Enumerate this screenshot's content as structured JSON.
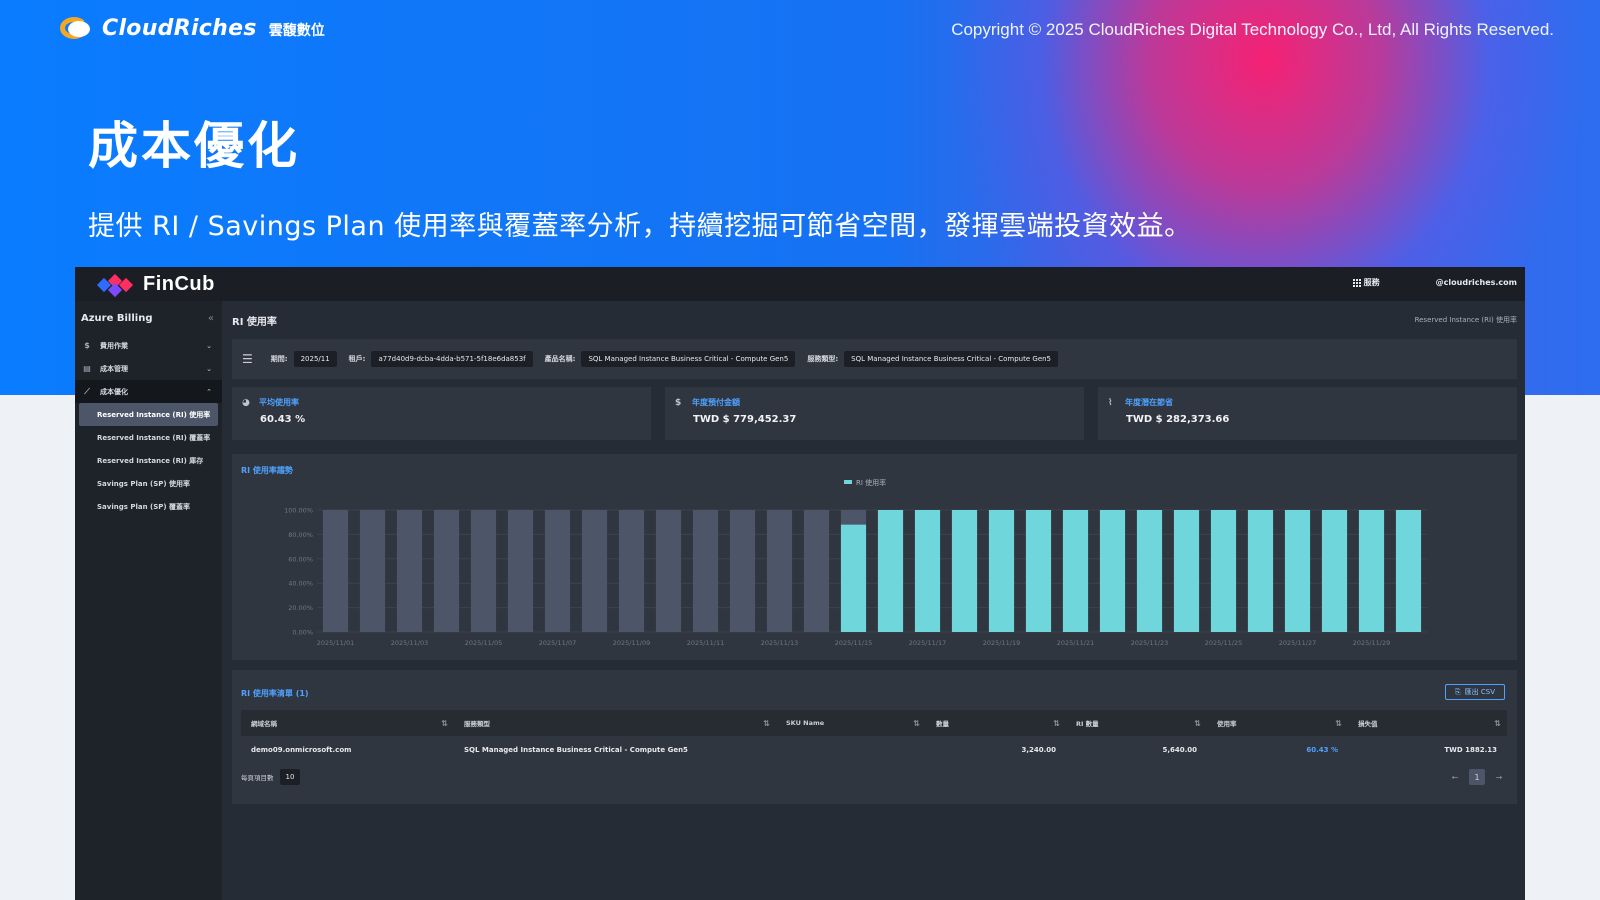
{
  "hero": {
    "brand_name": "CloudRiches",
    "brand_cn": "雲馥數位",
    "copyright": "Copyright © 2025 CloudRiches Digital Technology Co., Ltd, All Rights Reserved.",
    "title": "成本優化",
    "subtitle": "提供 RI / Savings Plan 使用率與覆蓋率分析，持續挖掘可節省空間，發揮雲端投資效益。"
  },
  "app": {
    "logo_text": "FinCub",
    "apps_label": "服務",
    "account": "@cloudriches.com",
    "sidebar": {
      "title": "Azure Billing",
      "collapse_icon": "«",
      "groups": [
        {
          "label": "費用作業",
          "icon": "dollar-icon",
          "expanded": false
        },
        {
          "label": "成本管理",
          "icon": "chart-box-icon",
          "expanded": false
        },
        {
          "label": "成本優化",
          "icon": "trend-icon",
          "expanded": true
        }
      ],
      "sub_items": [
        {
          "label": "Reserved Instance (RI) 使用率",
          "active": true
        },
        {
          "label": "Reserved Instance (RI) 覆蓋率",
          "active": false
        },
        {
          "label": "Reserved Instance (RI) 庫存",
          "active": false
        },
        {
          "label": "Savings Plan (SP) 使用率",
          "active": false
        },
        {
          "label": "Savings Plan (SP) 覆蓋率",
          "active": false
        }
      ]
    },
    "page": {
      "title": "RI 使用率",
      "breadcrumb": "Reserved Instance (RI) 使用率"
    },
    "filters": {
      "period_label": "期間:",
      "period_value": "2025/11",
      "tenant_label": "租戶:",
      "tenant_value": "a77d40d9-dcba-4dda-b571-5f18e6da853f",
      "product_label": "產品名稱:",
      "product_value": "SQL Managed Instance Business Critical - Compute Gen5",
      "service_label": "服務類型:",
      "service_value": "SQL Managed Instance Business Critical - Compute Gen5"
    },
    "kpis": [
      {
        "label": "平均使用率",
        "value": "60.43 %",
        "icon": "pie-icon"
      },
      {
        "label": "年度預付金額",
        "value": "TWD $ 779,452.37",
        "icon": "dollar-icon"
      },
      {
        "label": "年度潛在節省",
        "value": "TWD $ 282,373.66",
        "icon": "line-chart-icon"
      }
    ],
    "table": {
      "title": "RI 使用率清單 (1)",
      "export_label": "匯出 CSV",
      "columns": [
        "網域名稱",
        "服務類型",
        "SKU Name",
        "數量",
        "RI 數量",
        "使用率",
        "損失值"
      ],
      "rows": [
        [
          "demo09.onmicrosoft.com",
          "SQL Managed Instance Business Critical - Compute Gen5",
          "",
          "3,240.00",
          "5,640.00",
          "60.43 %",
          "TWD 1882.13"
        ]
      ],
      "page_size_label": "每頁項目數",
      "page_size": "10",
      "current_page": "1"
    }
  },
  "colors": {
    "accent": "#4ea2ff",
    "bar_used": "#6fd6dc",
    "bar_unused": "#4c5668"
  },
  "chart_data": {
    "type": "bar",
    "title": "RI 使用率趨勢",
    "series": [
      {
        "name": "RI 使用率",
        "values": [
          0,
          0,
          0,
          0,
          0,
          0,
          0,
          0,
          0,
          0,
          0,
          0,
          0,
          0,
          88,
          100,
          100,
          100,
          100,
          100,
          100,
          100,
          100,
          100,
          100,
          100,
          100,
          100,
          100,
          100
        ]
      }
    ],
    "categories": [
      "2025/11/01",
      "2025/11/02",
      "2025/11/03",
      "2025/11/04",
      "2025/11/05",
      "2025/11/06",
      "2025/11/07",
      "2025/11/08",
      "2025/11/09",
      "2025/11/10",
      "2025/11/11",
      "2025/11/12",
      "2025/11/13",
      "2025/11/14",
      "2025/11/15",
      "2025/11/16",
      "2025/11/17",
      "2025/11/18",
      "2025/11/19",
      "2025/11/20",
      "2025/11/21",
      "2025/11/22",
      "2025/11/23",
      "2025/11/24",
      "2025/11/25",
      "2025/11/26",
      "2025/11/27",
      "2025/11/28",
      "2025/11/29",
      "2025/11/30"
    ],
    "x_tick_labels": [
      "2025/11/01",
      "2025/11/03",
      "2025/11/05",
      "2025/11/07",
      "2025/11/09",
      "2025/11/11",
      "2025/11/13",
      "2025/11/15",
      "2025/11/17",
      "2025/11/19",
      "2025/11/21",
      "2025/11/23",
      "2025/11/25",
      "2025/11/27",
      "2025/11/29"
    ],
    "y_tick_labels": [
      "0.00%",
      "20.00%",
      "40.00%",
      "60.00%",
      "80.00%",
      "100.00%"
    ],
    "ylim": [
      0,
      100
    ],
    "legend_position": "top-center",
    "grid": true,
    "background_bars": true
  }
}
